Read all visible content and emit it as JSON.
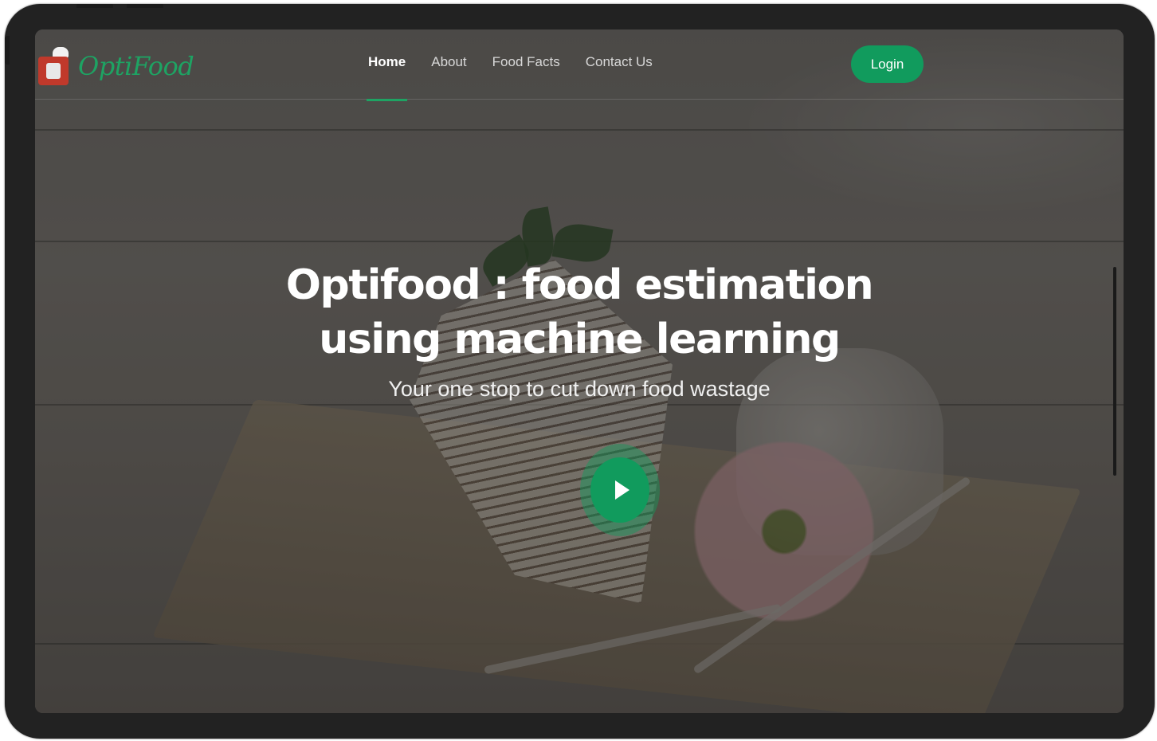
{
  "brand": {
    "name": "OptiFood"
  },
  "nav": {
    "items": [
      {
        "label": "Home",
        "active": true
      },
      {
        "label": "About",
        "active": false
      },
      {
        "label": "Food Facts",
        "active": false
      },
      {
        "label": "Contact Us",
        "active": false
      }
    ],
    "login_label": "Login"
  },
  "hero": {
    "title": "Optifood : food estimation using machine learning",
    "subtitle": "Your one stop to cut down food wastage",
    "play_icon": "play-icon"
  },
  "colors": {
    "accent": "#119b5d",
    "logo_green": "#1ea363",
    "device_frame": "#222222"
  }
}
